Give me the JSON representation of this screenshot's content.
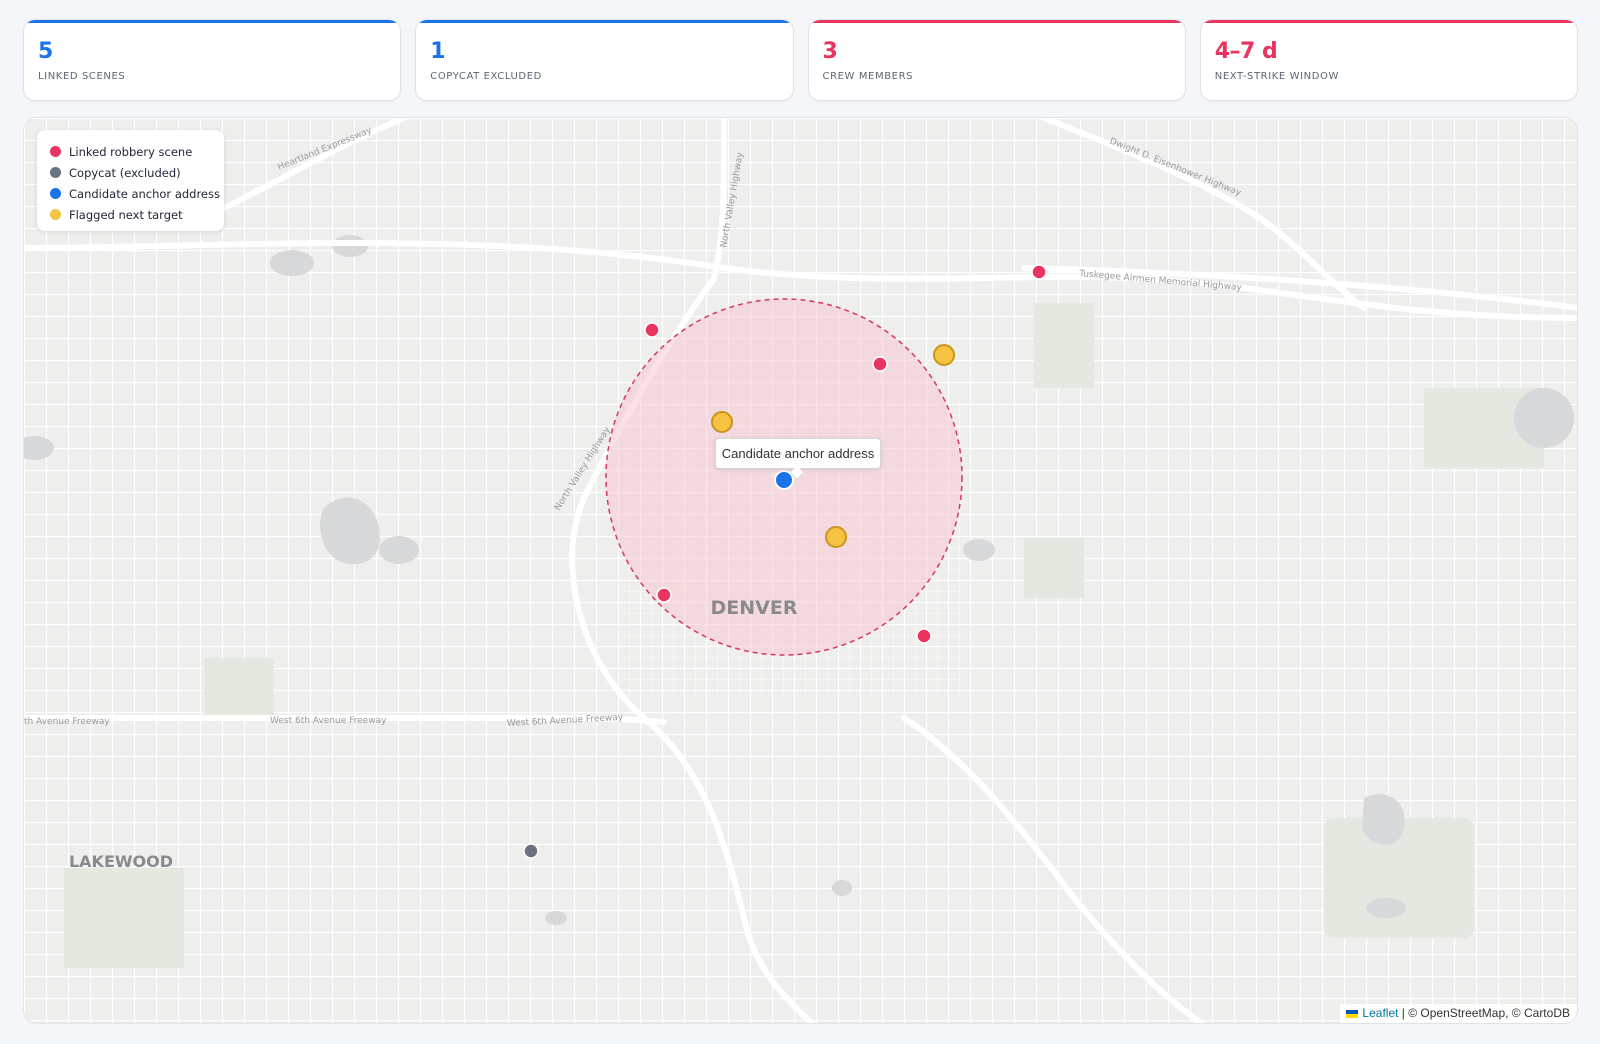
{
  "stats": [
    {
      "value": "5",
      "label": "Linked Scenes",
      "color": "#1a73e8"
    },
    {
      "value": "1",
      "label": "Copycat Excluded",
      "color": "#1a73e8"
    },
    {
      "value": "3",
      "label": "Crew Members",
      "color": "#e8345e"
    },
    {
      "value": "4–7 d",
      "label": "Next-Strike Window",
      "color": "#e8345e"
    }
  ],
  "legend": [
    {
      "label": "Linked robbery scene",
      "color": "#e8345e"
    },
    {
      "label": "Copycat (excluded)",
      "color": "#6b7280"
    },
    {
      "label": "Candidate anchor address",
      "color": "#1a73e8"
    },
    {
      "label": "Flagged next target",
      "color": "#f5c242"
    }
  ],
  "map": {
    "labels": {
      "denver": "DENVER",
      "lakewood": "LAKEWOOD",
      "heartland": "Heartland Expressway",
      "north_valley_1": "North Valley Highway",
      "north_valley_2": "North Valley Highway",
      "eisenhower": "Dwight D. Eisenhower Highway",
      "tuskegee": "Tuskegee Airmen Memorial Highway",
      "sixth_1": "th Avenue Freeway",
      "sixth_2": "West 6th Avenue Freeway",
      "sixth_3": "West 6th Avenue Freeway"
    },
    "tooltip": "Candidate anchor address",
    "attribution": {
      "link": "Leaflet",
      "rest": " | © OpenStreetMap, © CartoDB"
    },
    "colors": {
      "scene": "#e8345e",
      "copycat": "#6b7280",
      "anchor": "#1a73e8",
      "target": "#f5c242",
      "zone_fill": "#f7c9d4",
      "zone_stroke": "#d6385d"
    }
  }
}
